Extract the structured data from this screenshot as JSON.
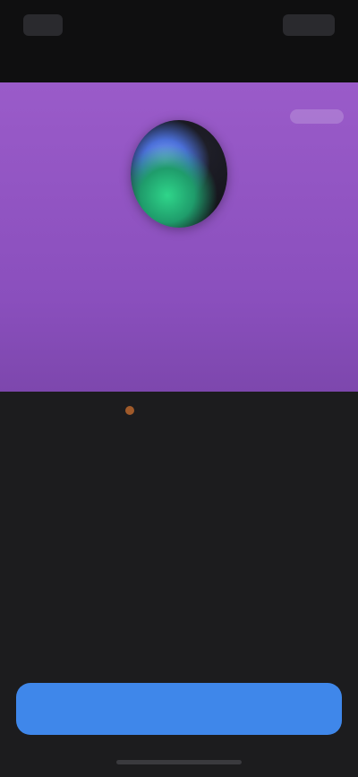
{
  "topbar": {
    "back_label": "",
    "title": "",
    "action_label": ""
  },
  "profile": {
    "tag": "",
    "username": "",
    "stats": [
      {
        "value": "",
        "label": ""
      },
      {
        "value": "",
        "label": ""
      },
      {
        "value": "",
        "label": ""
      }
    ]
  },
  "info_rows": [
    {
      "label": "",
      "value": "",
      "link": ""
    },
    {
      "label": "",
      "value": "",
      "link": ""
    },
    {
      "label": "",
      "value": "",
      "link": ""
    },
    {
      "label": "",
      "value": "",
      "link": ""
    },
    {
      "label": "",
      "value": "",
      "link": ""
    }
  ],
  "notice": {
    "text_before": "",
    "warn": "",
    "text_after": ""
  },
  "secondary_link": "",
  "primary_button": "",
  "colors": {
    "card_purple": "#8f54c3",
    "primary_blue": "#3f87ea",
    "link_blue": "#3a76d6",
    "warning_red": "#c0444c",
    "background": "#1c1c1e"
  }
}
